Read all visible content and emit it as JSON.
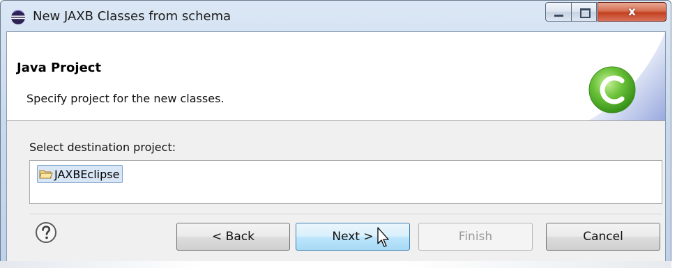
{
  "window": {
    "title": "New JAXB Classes from schema",
    "close_glyph": "x"
  },
  "banner": {
    "title": "Java Project",
    "description": "Specify project for the new classes."
  },
  "destination": {
    "label": "Select destination project:",
    "projects": [
      {
        "label": "JAXBEclipse",
        "selected": true
      }
    ]
  },
  "buttons": {
    "back": "< Back",
    "next": "Next >",
    "finish": "Finish",
    "cancel": "Cancel"
  },
  "colors": {
    "next_border": "#3c7fb1",
    "banner_logo": "#5cb82c",
    "close_button": "#c2401f"
  },
  "icons": {
    "window": "eclipse-icon",
    "banner": "eclipse-c-logo-icon",
    "project": "open-folder-icon",
    "help": "help-icon"
  }
}
